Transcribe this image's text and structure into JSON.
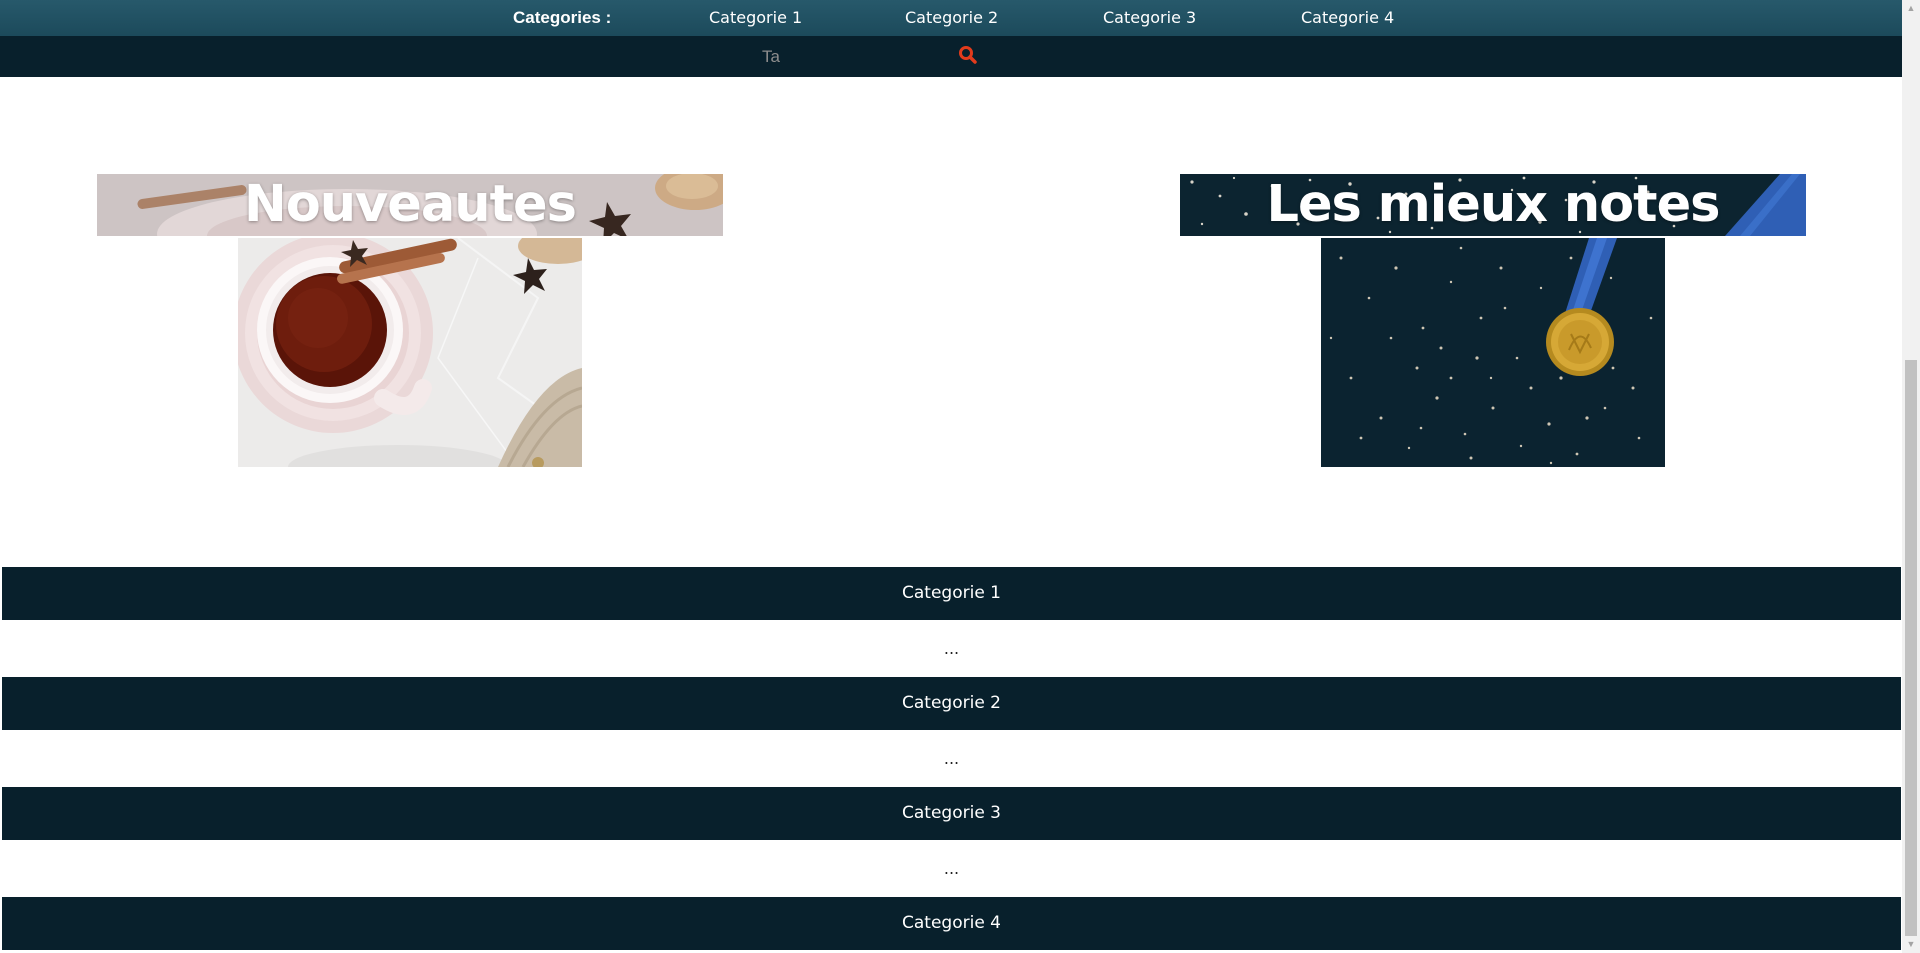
{
  "nav": {
    "label": "Categories :",
    "items": [
      "Categorie 1",
      "Categorie 2",
      "Categorie 3",
      "Categorie 4"
    ]
  },
  "search": {
    "placeholder": "Ta",
    "icon": "search-icon",
    "icon_color": "#e23b1c"
  },
  "features": {
    "new": {
      "title": "Nouveautes",
      "image": "tea-cup-photo"
    },
    "top_rated": {
      "title": "Les mieux notes",
      "image": "gold-medal-photo"
    }
  },
  "categories": [
    {
      "title": "Categorie 1",
      "content": "..."
    },
    {
      "title": "Categorie 2",
      "content": "..."
    },
    {
      "title": "Categorie 3",
      "content": "..."
    },
    {
      "title": "Categorie 4"
    }
  ],
  "colors": {
    "nav_bg": "#1f4e60",
    "dark_bg": "#08202c",
    "text_light": "#ffffff"
  }
}
